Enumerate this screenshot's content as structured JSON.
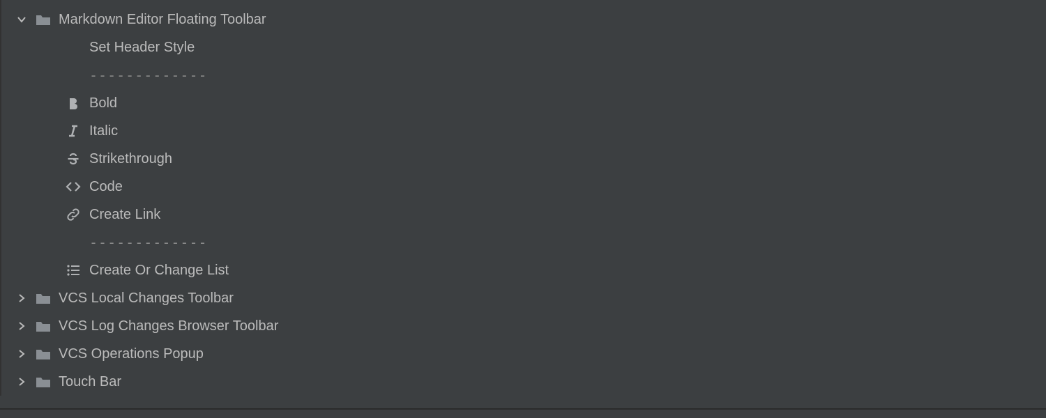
{
  "tree": {
    "expanded": {
      "label": "Markdown Editor Floating Toolbar",
      "children": [
        {
          "kind": "action",
          "label": "Set Header Style",
          "icon": null
        },
        {
          "kind": "separator",
          "text": "-------------"
        },
        {
          "kind": "action",
          "label": "Bold",
          "icon": "bold"
        },
        {
          "kind": "action",
          "label": "Italic",
          "icon": "italic"
        },
        {
          "kind": "action",
          "label": "Strikethrough",
          "icon": "strikethrough"
        },
        {
          "kind": "action",
          "label": "Code",
          "icon": "code"
        },
        {
          "kind": "action",
          "label": "Create Link",
          "icon": "link"
        },
        {
          "kind": "separator",
          "text": "-------------"
        },
        {
          "kind": "action",
          "label": "Create Or Change List",
          "icon": "list"
        }
      ]
    },
    "collapsed": [
      {
        "label": "VCS Local Changes Toolbar"
      },
      {
        "label": "VCS Log Changes Browser Toolbar"
      },
      {
        "label": "VCS Operations Popup"
      },
      {
        "label": "Touch Bar"
      }
    ]
  }
}
